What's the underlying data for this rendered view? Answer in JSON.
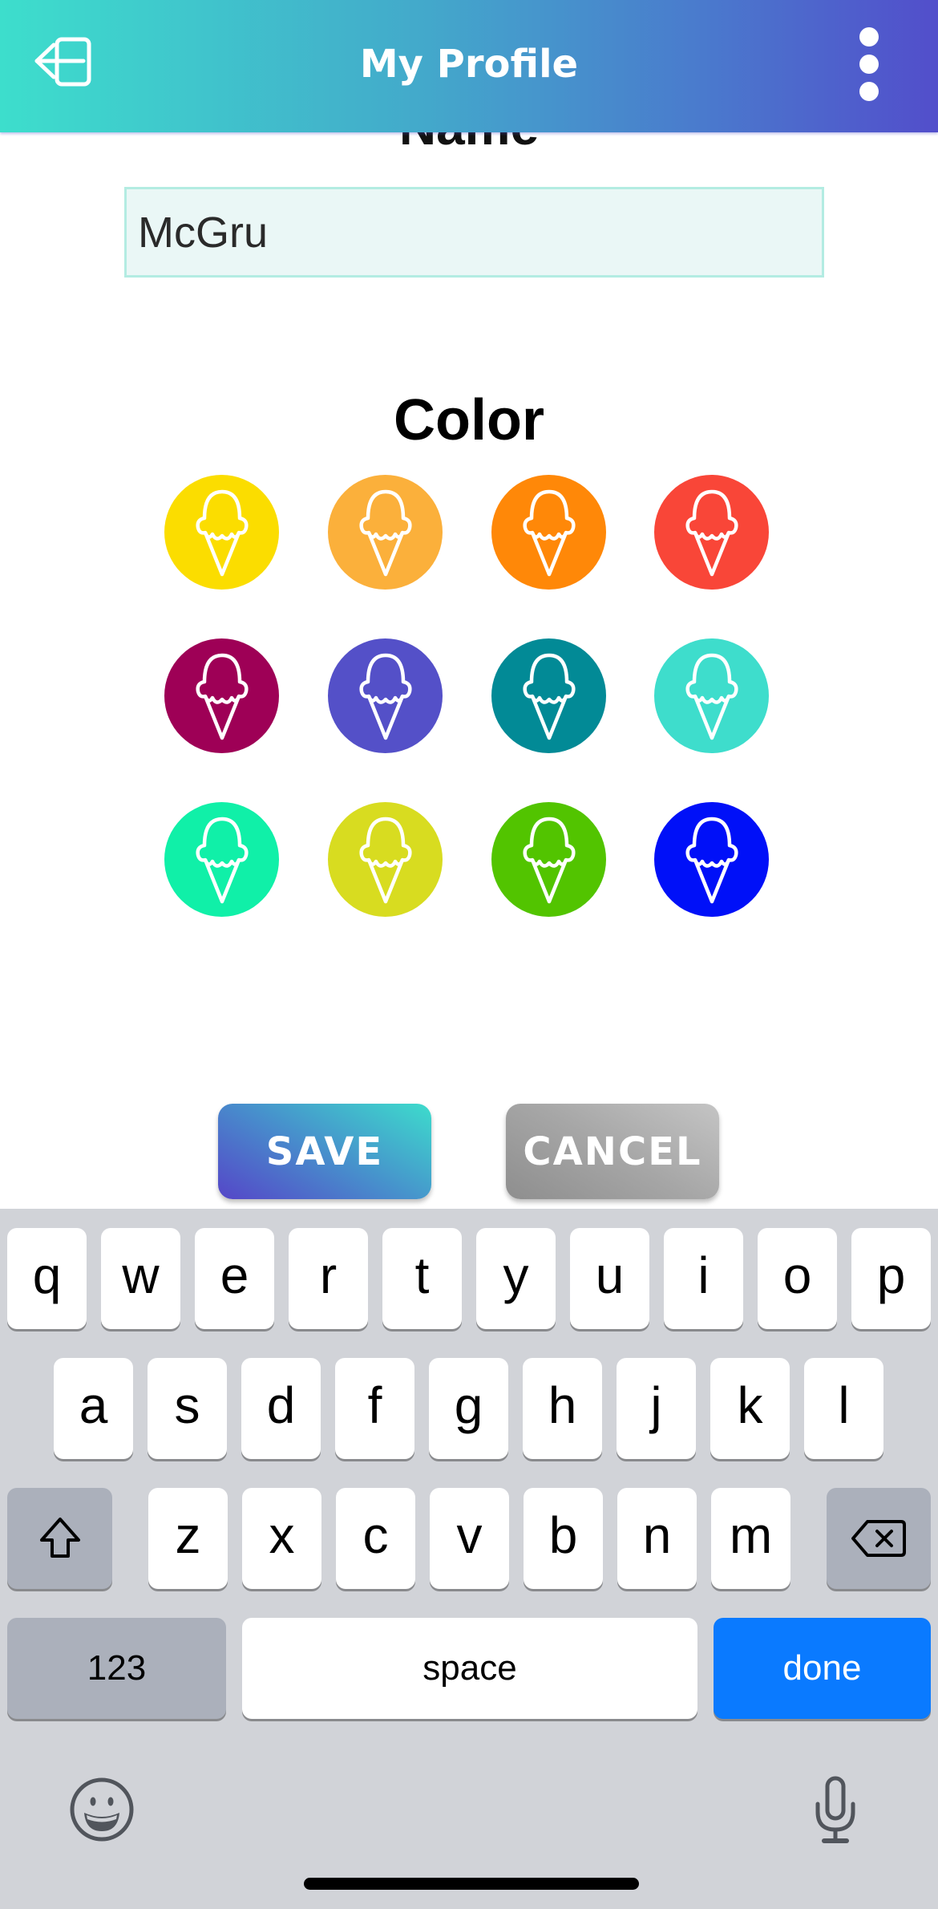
{
  "header": {
    "title": "My Profile",
    "left_icon": "logout-icon",
    "right_icon": "more-vertical-icon",
    "gradient": [
      "#3ddecc",
      "#524ecb"
    ]
  },
  "form": {
    "name_label": "Name",
    "name_value": "McGru",
    "color_label": "Color",
    "swatch_icon": "ice-cream-cone-icon",
    "colors": [
      "#fbdd00",
      "#fbb03b",
      "#ff8808",
      "#f94638",
      "#9e0056",
      "#5450c8",
      "#028a96",
      "#3eddcc",
      "#10f0a8",
      "#d8dc20",
      "#52c400",
      "#0010f8"
    ]
  },
  "actions": {
    "save_label": "SAVE",
    "cancel_label": "CANCEL"
  },
  "keyboard": {
    "row1": [
      "q",
      "w",
      "e",
      "r",
      "t",
      "y",
      "u",
      "i",
      "o",
      "p"
    ],
    "row2": [
      "a",
      "s",
      "d",
      "f",
      "g",
      "h",
      "j",
      "k",
      "l"
    ],
    "row3": [
      "z",
      "x",
      "c",
      "v",
      "b",
      "n",
      "m"
    ],
    "shift_icon": "shift-icon",
    "delete_icon": "backspace-icon",
    "numbers_label": "123",
    "space_label": "space",
    "done_label": "done",
    "emoji_icon": "emoji-icon",
    "mic_icon": "microphone-icon",
    "done_color": "#0a7aff"
  }
}
